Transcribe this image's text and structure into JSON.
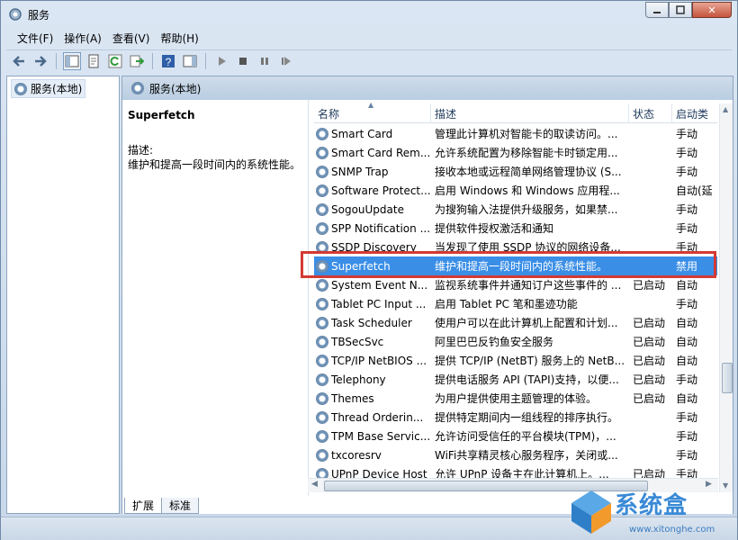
{
  "window": {
    "title": "服务",
    "min_icon": "minimize-icon",
    "max_icon": "maximize-icon",
    "close_label": "✕"
  },
  "menu": [
    "文件(F)",
    "操作(A)",
    "查看(V)",
    "帮助(H)"
  ],
  "toolbar": {
    "icons": [
      "back-arrow-icon",
      "forward-arrow-icon",
      "console-tree-icon",
      "properties-icon",
      "refresh-icon",
      "export-icon",
      "help-icon",
      "action-pane-icon",
      "play-icon",
      "stop-icon",
      "pause-icon",
      "restart-icon"
    ]
  },
  "tree": {
    "root_label": "服务(本地)"
  },
  "right_pane": {
    "header": "服务(本地)",
    "selected_title": "Superfetch",
    "desc_label": "描述:",
    "desc_text": "维护和提高一段时间内的系统性能。"
  },
  "columns": [
    "名称",
    "描述",
    "状态",
    "启动类"
  ],
  "rows": [
    {
      "name": "Smart Card",
      "desc": "管理此计算机对智能卡的取读访问。...",
      "status": "",
      "start": "手动"
    },
    {
      "name": "Smart Card Rem...",
      "desc": "允许系统配置为移除智能卡时锁定用...",
      "status": "",
      "start": "手动"
    },
    {
      "name": "SNMP Trap",
      "desc": "接收本地或远程简单网络管理协议 (S...",
      "status": "",
      "start": "手动"
    },
    {
      "name": "Software Protect...",
      "desc": "启用 Windows 和 Windows 应用程...",
      "status": "",
      "start": "自动(延"
    },
    {
      "name": "SogouUpdate",
      "desc": "为搜狗输入法提供升级服务，如果禁...",
      "status": "",
      "start": "手动"
    },
    {
      "name": "SPP Notification ...",
      "desc": "提供软件授权激活和通知",
      "status": "",
      "start": "手动"
    },
    {
      "name": "SSDP Discovery",
      "desc": "当发现了使用 SSDP 协议的网络设备...",
      "status": "",
      "start": "手动"
    },
    {
      "name": "Superfetch",
      "desc": "维护和提高一段时间内的系统性能。",
      "status": "",
      "start": "禁用",
      "selected": true
    },
    {
      "name": "System Event N...",
      "desc": "监视系统事件并通知订户这些事件的 ...",
      "status": "已启动",
      "start": "自动"
    },
    {
      "name": "Tablet PC Input ...",
      "desc": "启用 Tablet PC 笔和墨迹功能",
      "status": "",
      "start": "手动"
    },
    {
      "name": "Task Scheduler",
      "desc": "使用户可以在此计算机上配置和计划...",
      "status": "已启动",
      "start": "自动"
    },
    {
      "name": "TBSecSvc",
      "desc": "阿里巴巴反钓鱼安全服务",
      "status": "已启动",
      "start": "自动"
    },
    {
      "name": "TCP/IP NetBIOS ...",
      "desc": "提供 TCP/IP (NetBT) 服务上的 NetB...",
      "status": "已启动",
      "start": "自动"
    },
    {
      "name": "Telephony",
      "desc": "提供电话服务 API (TAPI)支持，以便...",
      "status": "已启动",
      "start": "手动"
    },
    {
      "name": "Themes",
      "desc": "为用户提供使用主题管理的体验。",
      "status": "已启动",
      "start": "自动"
    },
    {
      "name": "Thread Orderin...",
      "desc": "提供特定期间内一组线程的排序执行。",
      "status": "",
      "start": "手动"
    },
    {
      "name": "TPM Base Servic...",
      "desc": "允许访问受信任的平台模块(TPM)，...",
      "status": "",
      "start": "手动"
    },
    {
      "name": "txcoresrv",
      "desc": "WiFi共享精灵核心服务程序，关闭或...",
      "status": "",
      "start": "手动"
    },
    {
      "name": "UPnP Device Host",
      "desc": "允许 UPnP 设备主在此计算机上。...",
      "status": "已启动",
      "start": "手动"
    }
  ],
  "tabs": [
    "扩展",
    "标准"
  ],
  "watermark": {
    "brand": "系统盒",
    "url": "www.xitonghe.com"
  }
}
